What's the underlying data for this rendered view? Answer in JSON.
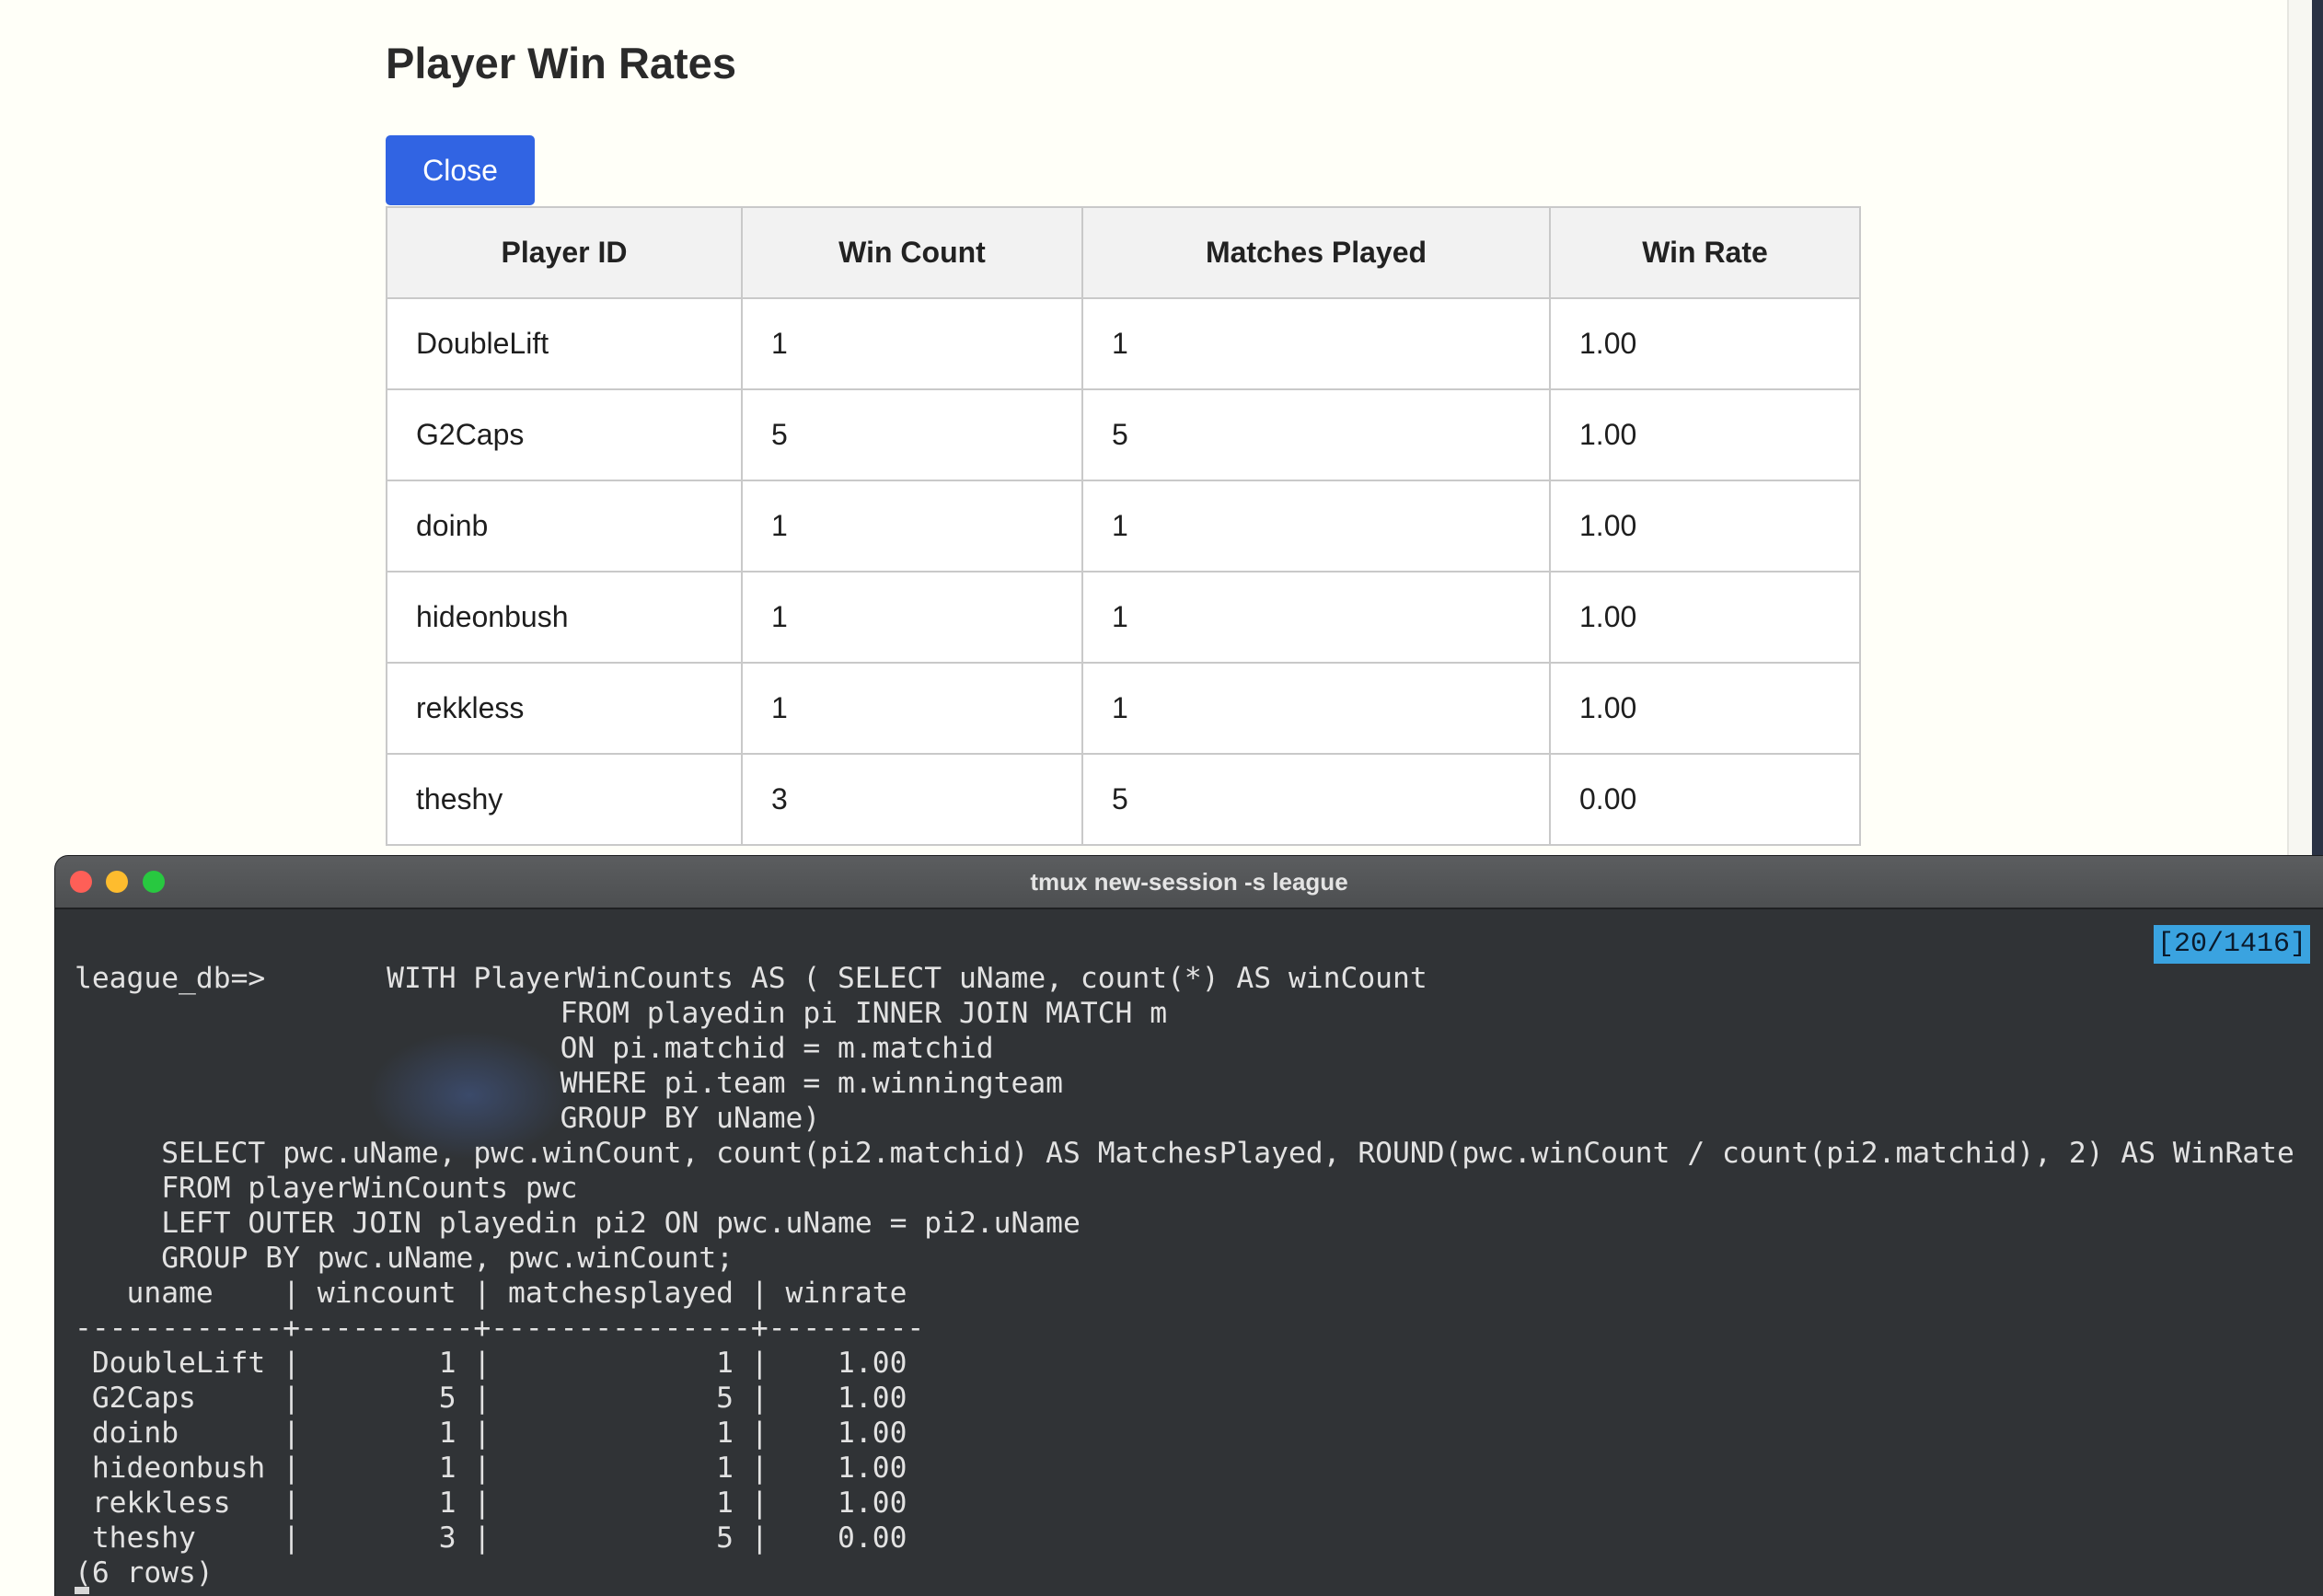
{
  "page": {
    "title": "Player Win Rates",
    "close_label": "Close",
    "table": {
      "headers": [
        "Player ID",
        "Win Count",
        "Matches Played",
        "Win Rate"
      ],
      "rows": [
        [
          "DoubleLift",
          "1",
          "1",
          "1.00"
        ],
        [
          "G2Caps",
          "5",
          "5",
          "1.00"
        ],
        [
          "doinb",
          "1",
          "1",
          "1.00"
        ],
        [
          "hideonbush",
          "1",
          "1",
          "1.00"
        ],
        [
          "rekkless",
          "1",
          "1",
          "1.00"
        ],
        [
          "theshy",
          "3",
          "5",
          "0.00"
        ]
      ]
    }
  },
  "terminal": {
    "window_title": "tmux new-session -s league",
    "scroll_position": "[20/1416]",
    "lines": [
      "league_db=>       WITH PlayerWinCounts AS ( SELECT uName, count(*) AS winCount",
      "                            FROM playedin pi INNER JOIN MATCH m",
      "                            ON pi.matchid = m.matchid",
      "                            WHERE pi.team = m.winningteam",
      "                            GROUP BY uName)",
      "     SELECT pwc.uName, pwc.winCount, count(pi2.matchid) AS MatchesPlayed, ROUND(pwc.winCount / count(pi2.matchid), 2) AS WinRate",
      "     FROM playerWinCounts pwc",
      "     LEFT OUTER JOIN playedin pi2 ON pwc.uName = pi2.uName",
      "     GROUP BY pwc.uName, pwc.winCount;",
      "   uname    | wincount | matchesplayed | winrate",
      "------------+----------+---------------+---------",
      " DoubleLift |        1 |             1 |    1.00",
      " G2Caps     |        5 |             5 |    1.00",
      " doinb      |        1 |             1 |    1.00",
      " hideonbush |        1 |             1 |    1.00",
      " rekkless   |        1 |             1 |    1.00",
      " theshy     |        3 |             5 |    0.00",
      "(6 rows)"
    ]
  },
  "colors": {
    "accent": "#3164e3",
    "terminal_bg": "#303336",
    "scroll_indicator": "#3aa3e0"
  }
}
